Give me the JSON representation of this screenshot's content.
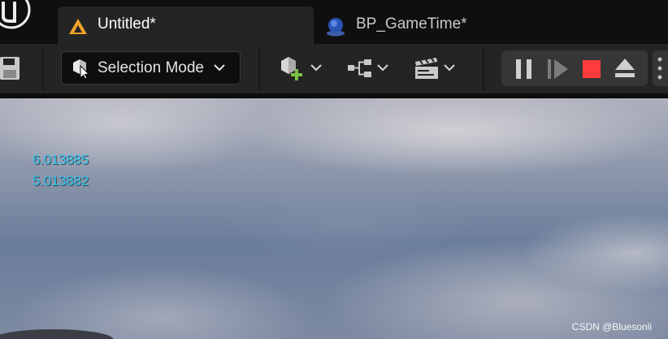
{
  "tabs": [
    {
      "label": "Untitled*",
      "icon": "level-icon",
      "active": true
    },
    {
      "label": "BP_GameTime*",
      "icon": "blueprint-icon",
      "active": false
    }
  ],
  "toolbar": {
    "mode_label": "Selection Mode",
    "mode_icon": "selection-mode-icon",
    "tools": [
      "add-actor-icon",
      "blueprint-graph-icon",
      "cinematics-icon"
    ],
    "play_controls": [
      "pause-icon",
      "step-frame-icon",
      "stop-icon",
      "eject-icon"
    ],
    "stop_color": "#ff3b3b"
  },
  "viewport": {
    "debug_lines": [
      "6.013885",
      "5.013882"
    ],
    "debug_color": "#33c3f0",
    "watermark": "CSDN @Bluesonli"
  },
  "colors": {
    "accent_orange": "#f0a22a",
    "tab_active_bg": "#242424",
    "tabbar_bg": "#0f0f0f"
  }
}
